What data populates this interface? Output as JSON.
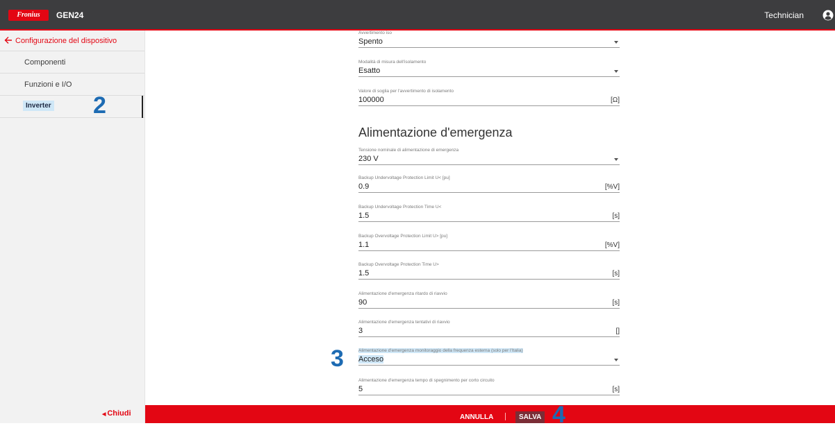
{
  "header": {
    "logo_text": "Fronius",
    "product": "GEN24",
    "user_role": "Technician"
  },
  "sidebar": {
    "back_label": "Configurazione del dispositivo",
    "items": [
      {
        "label": "Componenti",
        "active": false
      },
      {
        "label": "Funzioni e I/O",
        "active": false
      },
      {
        "label": "Inverter",
        "active": true
      }
    ],
    "close_label": "Chiudi"
  },
  "annotations": {
    "n2": "2",
    "n3": "3",
    "n4": "4"
  },
  "form": {
    "iso_fields": [
      {
        "label": "Avvertimento iso",
        "value": "Spento",
        "unit": "",
        "type": "select"
      },
      {
        "label": "Modalità di misura dell'isolamento",
        "value": "Esatto",
        "unit": "",
        "type": "select"
      },
      {
        "label": "Valore di soglia per l'avvertimento di isolamento",
        "value": "100000",
        "unit": "[Ω]",
        "type": "input"
      }
    ],
    "section_title": "Alimentazione d'emergenza",
    "emergency_fields": [
      {
        "label": "Tensione nominale di alimentazione di emergenza",
        "value": "230 V",
        "unit": "",
        "type": "select"
      },
      {
        "label": "Backup Undervoltage Protection Limit U< [pu]",
        "value": "0.9",
        "unit": "[%V]",
        "type": "input"
      },
      {
        "label": "Backup Undervoltage Protection Time U<",
        "value": "1.5",
        "unit": "[s]",
        "type": "input"
      },
      {
        "label": "Backup Overvoltage Protection Limit U> [pu]",
        "value": "1.1",
        "unit": "[%V]",
        "type": "input"
      },
      {
        "label": "Backup Overvoltage Protection Time U>",
        "value": "1.5",
        "unit": "[s]",
        "type": "input"
      },
      {
        "label": "Alimentazione d'emergenza ritardo di riavvio",
        "value": "90",
        "unit": "[s]",
        "type": "input"
      },
      {
        "label": "Alimentazione d'emergenza tentativi di riavvio",
        "value": "3",
        "unit": "[]",
        "type": "input"
      },
      {
        "label": "Alimentazione d'emergenza monitoraggio della frequenza esterna (solo per l'Italia)",
        "value": "Acceso",
        "unit": "",
        "type": "select"
      },
      {
        "label": "Alimentazione d'emergenza tempo di spegnimento per corto circuito",
        "value": "5",
        "unit": "[s]",
        "type": "input"
      }
    ]
  },
  "footer": {
    "cancel_label": "ANNULLA",
    "save_label": "SALVA"
  },
  "colors": {
    "brand_red": "#e30613",
    "header_bg": "#3d3d3f",
    "highlight": "#cfe7f7",
    "annotation_blue": "#1d6bb3"
  }
}
